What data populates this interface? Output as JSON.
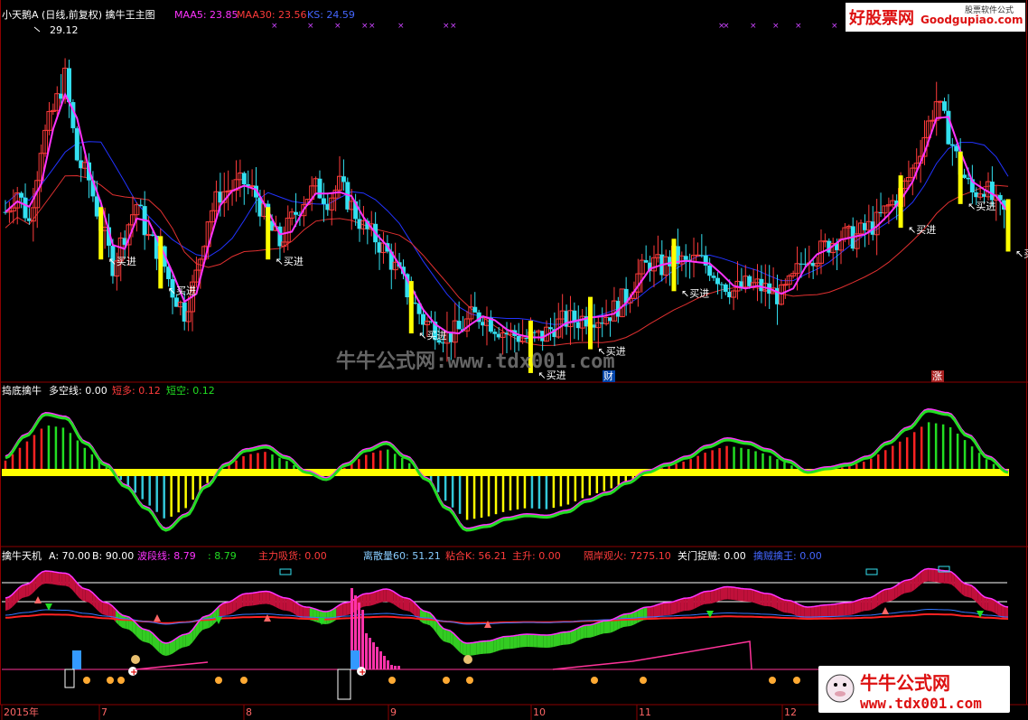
{
  "colors": {
    "bg": "#000000",
    "grid": "#8b0000",
    "up": "#ff3b3b",
    "down": "#33e0f0",
    "maa5": "#ff33ff",
    "maa30": "#e03030",
    "ks": "#2233ff",
    "yellow": "#ffff00",
    "green": "#22dd22",
    "text": "#ffffff"
  },
  "main_panel": {
    "title_prefix": "小天鹅A (日线,前复权) 擒牛王主图",
    "maa5_label": "MAA5: 23.85",
    "maa30_label": "MAA30: 23.56",
    "ks_label": "KS: 24.59",
    "high_price": "29.12",
    "buy_label": "买进",
    "cai_label": "财",
    "zhang_label": "涨"
  },
  "oscillator_panel": {
    "title": "捣底擒牛",
    "duokong_label": "多空线: 0.00",
    "duanduo_label": "短多: 0.12",
    "duankong_label": "短空: 0.12"
  },
  "bottom_panel": {
    "title": "擒牛天机",
    "a_label": "A: 70.00",
    "b_label": "B: 90.00",
    "boduan_label": "波段线: 8.79",
    "colon_label": ": 8.79",
    "zhuli_label": "主力吸货: 0.00",
    "lisan_label": "离散量60: 51.21",
    "zhanhe_label": "粘合K: 56.21",
    "zhusheng_label": "主升: 0.00",
    "gean_label": "隔岸观火: 7275.10",
    "guanmen_label": "关门捉贼: 0.00",
    "zhuizei_label": "擒贼擒王: 0.00"
  },
  "xaxis": {
    "labels": [
      "2015年",
      "7",
      "8",
      "9",
      "10",
      "11",
      "12"
    ]
  },
  "watermark": {
    "center": "牛牛公式网:www.tdx001.com",
    "logo_top": "好股票网",
    "logo_top_domain": "Goodgupiao.com",
    "logo_top_small": "股票软件公式",
    "logo_bottom": "牛牛公式网",
    "logo_bottom_url": "www.tdx001.com"
  },
  "chart_data": {
    "type": "candlestick",
    "prices": [
      24.0,
      24.8,
      23.6,
      26.5,
      27.8,
      29.1,
      26.0,
      25.2,
      23.5,
      22.0,
      23.2,
      24.3,
      23.0,
      22.4,
      21.0,
      20.2,
      21.6,
      23.8,
      24.7,
      24.9,
      25.1,
      24.6,
      23.5,
      22.8,
      23.7,
      24.5,
      24.9,
      24.5,
      25.0,
      24.2,
      23.4,
      23.0,
      22.4,
      21.6,
      20.7,
      19.9,
      19.6,
      19.3,
      19.5,
      20.0,
      20.1,
      19.7,
      19.4,
      19.3,
      19.2,
      19.3,
      19.7,
      19.9,
      19.9,
      20.1,
      20.0,
      20.3,
      20.8,
      21.6,
      22.1,
      21.9,
      22.3,
      22.0,
      22.2,
      21.9,
      21.4,
      21.0,
      21.2,
      21.2,
      21.0,
      20.8,
      21.4,
      22.4,
      22.4,
      22.8,
      23.1,
      23.0,
      23.3,
      23.6,
      24.2,
      24.7,
      25.6,
      26.9,
      28.2,
      27.0,
      25.6,
      24.7,
      25.0,
      24.2,
      23.8
    ],
    "maa5_ref": 23.85,
    "maa30_ref": 23.56,
    "ks_ref": 24.59,
    "high_marker": 29.12,
    "buy_signal_indices": [
      8,
      13,
      22,
      34,
      44,
      49,
      56,
      75,
      80,
      84
    ],
    "oscillator": [
      0.2,
      0.5,
      0.8,
      0.75,
      0.4,
      0.1,
      -0.2,
      -0.5,
      -0.8,
      -0.6,
      -0.2,
      0.1,
      0.3,
      0.35,
      0.2,
      0.0,
      -0.1,
      0.1,
      0.3,
      0.4,
      0.2,
      -0.1,
      -0.5,
      -0.8,
      -0.75,
      -0.65,
      -0.6,
      -0.62,
      -0.55,
      -0.4,
      -0.3,
      -0.15,
      0.0,
      0.1,
      0.2,
      0.35,
      0.45,
      0.4,
      0.3,
      0.15,
      0.0,
      0.05,
      0.1,
      0.2,
      0.4,
      0.6,
      0.85,
      0.8,
      0.5,
      0.2,
      0.0
    ],
    "y_range": [
      18.0,
      31.0
    ]
  }
}
